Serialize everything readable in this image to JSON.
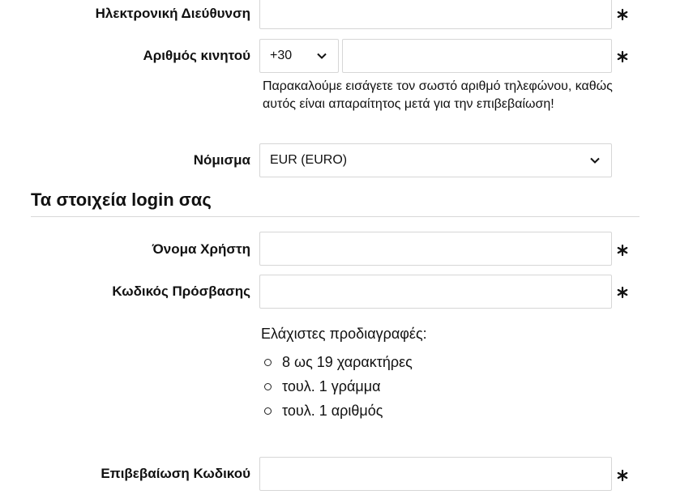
{
  "form": {
    "email": {
      "label": "Ηλεκτρονική Διεύθυνση",
      "value": "",
      "required_mark": "asterisk-icon"
    },
    "mobile": {
      "label": "Αριθμός κινητού",
      "country_code": "+30",
      "value": "",
      "hint": "Παρακαλούμε εισάγετε τον σωστό αριθμό τηλεφώνου, καθώς αυτός είναι απαραίτητος μετά για την επιβεβαίωση!",
      "required_mark": "asterisk-icon"
    },
    "currency": {
      "label": "Νόμισμα",
      "selected": "EUR (EURO)"
    }
  },
  "login_section": {
    "title": "Τα στοιχεία login σας",
    "username": {
      "label": "Όνομα Χρήστη",
      "value": ""
    },
    "password": {
      "label": "Κωδικός Πρόσβασης",
      "value": "",
      "spec_title": "Ελάχιστες προδιαγραφές:",
      "specs": [
        "8 ως 19 χαρακτήρες",
        "τουλ. 1 γράμμα",
        "τουλ. 1 αριθμός"
      ]
    },
    "confirm_password": {
      "label": "Επιβεβαίωση Κωδικού",
      "value": ""
    }
  },
  "colors": {
    "text": "#111111",
    "border": "#d6d6d6",
    "divider": "#d8d8d8",
    "background": "#ffffff"
  }
}
